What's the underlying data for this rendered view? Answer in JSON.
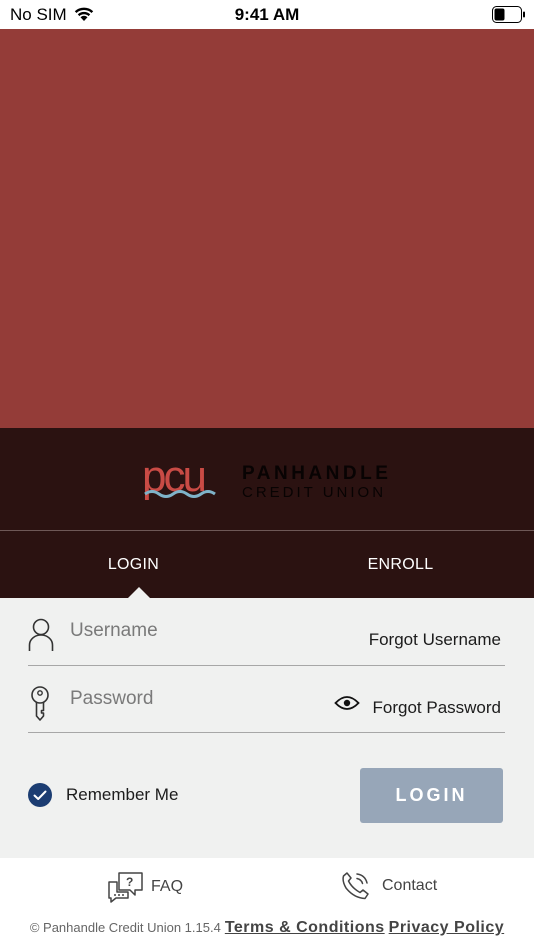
{
  "status_bar": {
    "carrier": "No SIM",
    "time": "9:41 AM",
    "wifi_icon": "wifi-icon",
    "battery_icon": "battery-icon"
  },
  "brand": {
    "logo_mark": "pcu",
    "logo_name_line1": "PANHANDLE",
    "logo_name_line2": "CREDIT UNION"
  },
  "tabs": {
    "login_label": "LOGIN",
    "enroll_label": "ENROLL",
    "active": "login"
  },
  "form": {
    "username": {
      "icon": "user-icon",
      "placeholder": "Username",
      "value": "",
      "forgot_label": "Forgot Username"
    },
    "password": {
      "icon": "key-icon",
      "placeholder": "Password",
      "value": "",
      "show_icon": "eye-icon",
      "forgot_label": "Forgot Password"
    },
    "remember_me": {
      "label": "Remember Me",
      "checked": true
    },
    "login_button_label": "LOGIN"
  },
  "footer": {
    "faq_label": "FAQ",
    "contact_label": "Contact",
    "copyright": "© Panhandle Credit Union 1.15.4",
    "terms_label": "Terms & Conditions",
    "privacy_label": "Privacy Policy"
  },
  "colors": {
    "hero": "#943c38",
    "brand_bar": "#2b1211",
    "form_bg": "#f0f1f0",
    "login_button": "#97a6b8",
    "checkbox": "#1c3d72",
    "logo_red": "#c94b45",
    "logo_wave": "#7fb3c9"
  }
}
